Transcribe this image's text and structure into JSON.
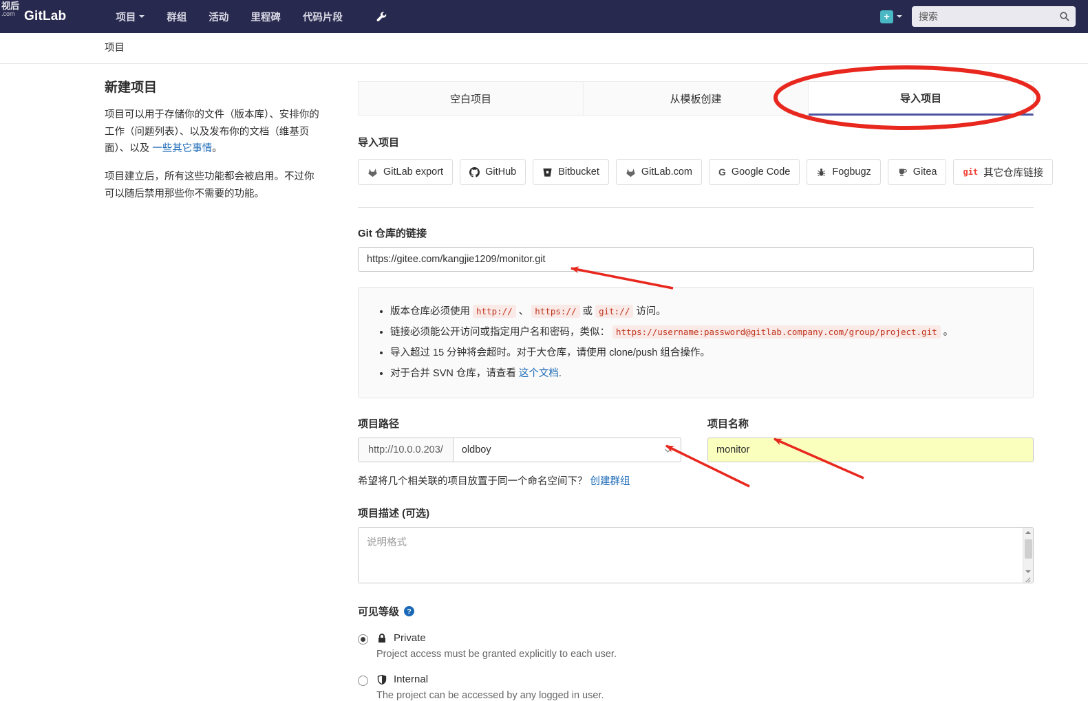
{
  "colors": {
    "navbar_bg": "#28294e",
    "accent_indigo": "#4c53a2",
    "link_blue": "#1b69b6",
    "annotation_red": "#e8281e",
    "autofill_yellow": "#faffbd",
    "code_red": "#c0341d"
  },
  "watermark": {
    "line1": "视后",
    "line2": ".com"
  },
  "navbar": {
    "logo": "GitLab",
    "menu": [
      "项目",
      "群组",
      "活动",
      "里程碑",
      "代码片段"
    ],
    "search_placeholder": "搜索"
  },
  "breadcrumb": {
    "current": "项目"
  },
  "intro": {
    "title": "新建项目",
    "p1_before": "项目可以用于存储你的文件（版本库）、安排你的工作（问题列表）、以及发布你的文档（维基页面）、以及 ",
    "p1_link": "一些其它事情",
    "p1_after": "。",
    "p2": "项目建立后，所有这些功能都会被启用。不过你可以随后禁用那些你不需要的功能。"
  },
  "tabs": {
    "blank": "空白项目",
    "template": "从模板创建",
    "import": "导入项目"
  },
  "import_section": {
    "title": "导入项目",
    "sources": [
      {
        "name": "gitlab-export",
        "label": "GitLab export"
      },
      {
        "name": "github",
        "label": "GitHub"
      },
      {
        "name": "bitbucket",
        "label": "Bitbucket"
      },
      {
        "name": "gitlab-com",
        "label": "GitLab.com"
      },
      {
        "name": "google-code",
        "label": "Google Code"
      },
      {
        "name": "fogbugz",
        "label": "Fogbugz"
      },
      {
        "name": "gitea",
        "label": "Gitea"
      },
      {
        "name": "git-repo-url",
        "label": "其它仓库链接"
      }
    ]
  },
  "repo_url": {
    "label": "Git 仓库的链接",
    "value": "https://gitee.com/kangjie1209/monitor.git"
  },
  "notes": {
    "b1_pre": "版本仓库必须使用 ",
    "b1_code1": "http://",
    "b1_mid1": " 、 ",
    "b1_code2": "https://",
    "b1_mid2": " 或 ",
    "b1_code3": "git://",
    "b1_post": " 访问。",
    "b2_pre": "链接必须能公开访问或指定用户名和密码，类似： ",
    "b2_code": "https://username:password@gitlab.company.com/group/project.git",
    "b2_post": " 。",
    "b3": "导入超过 15 分钟将会超时。对于大仓库，请使用 clone/push 组合操作。",
    "b4_pre": "对于合并 SVN 仓库，请查看 ",
    "b4_link": "这个文档",
    "b4_post": "."
  },
  "project_path": {
    "label": "项目路径",
    "url_prefix": "http://10.0.0.203/",
    "namespace": "oldboy"
  },
  "project_name": {
    "label": "项目名称",
    "value": "monitor"
  },
  "namespace_hint": {
    "text": "希望将几个相关联的项目放置于同一个命名空间下？ ",
    "link": "创建群组"
  },
  "description": {
    "label": "项目描述 (可选)",
    "placeholder": "说明格式"
  },
  "visibility": {
    "label": "可见等级",
    "options": [
      {
        "name": "private",
        "title": "Private",
        "desc": "Project access must be granted explicitly to each user.",
        "selected": true
      },
      {
        "name": "internal",
        "title": "Internal",
        "desc": "The project can be accessed by any logged in user.",
        "selected": false
      }
    ]
  }
}
